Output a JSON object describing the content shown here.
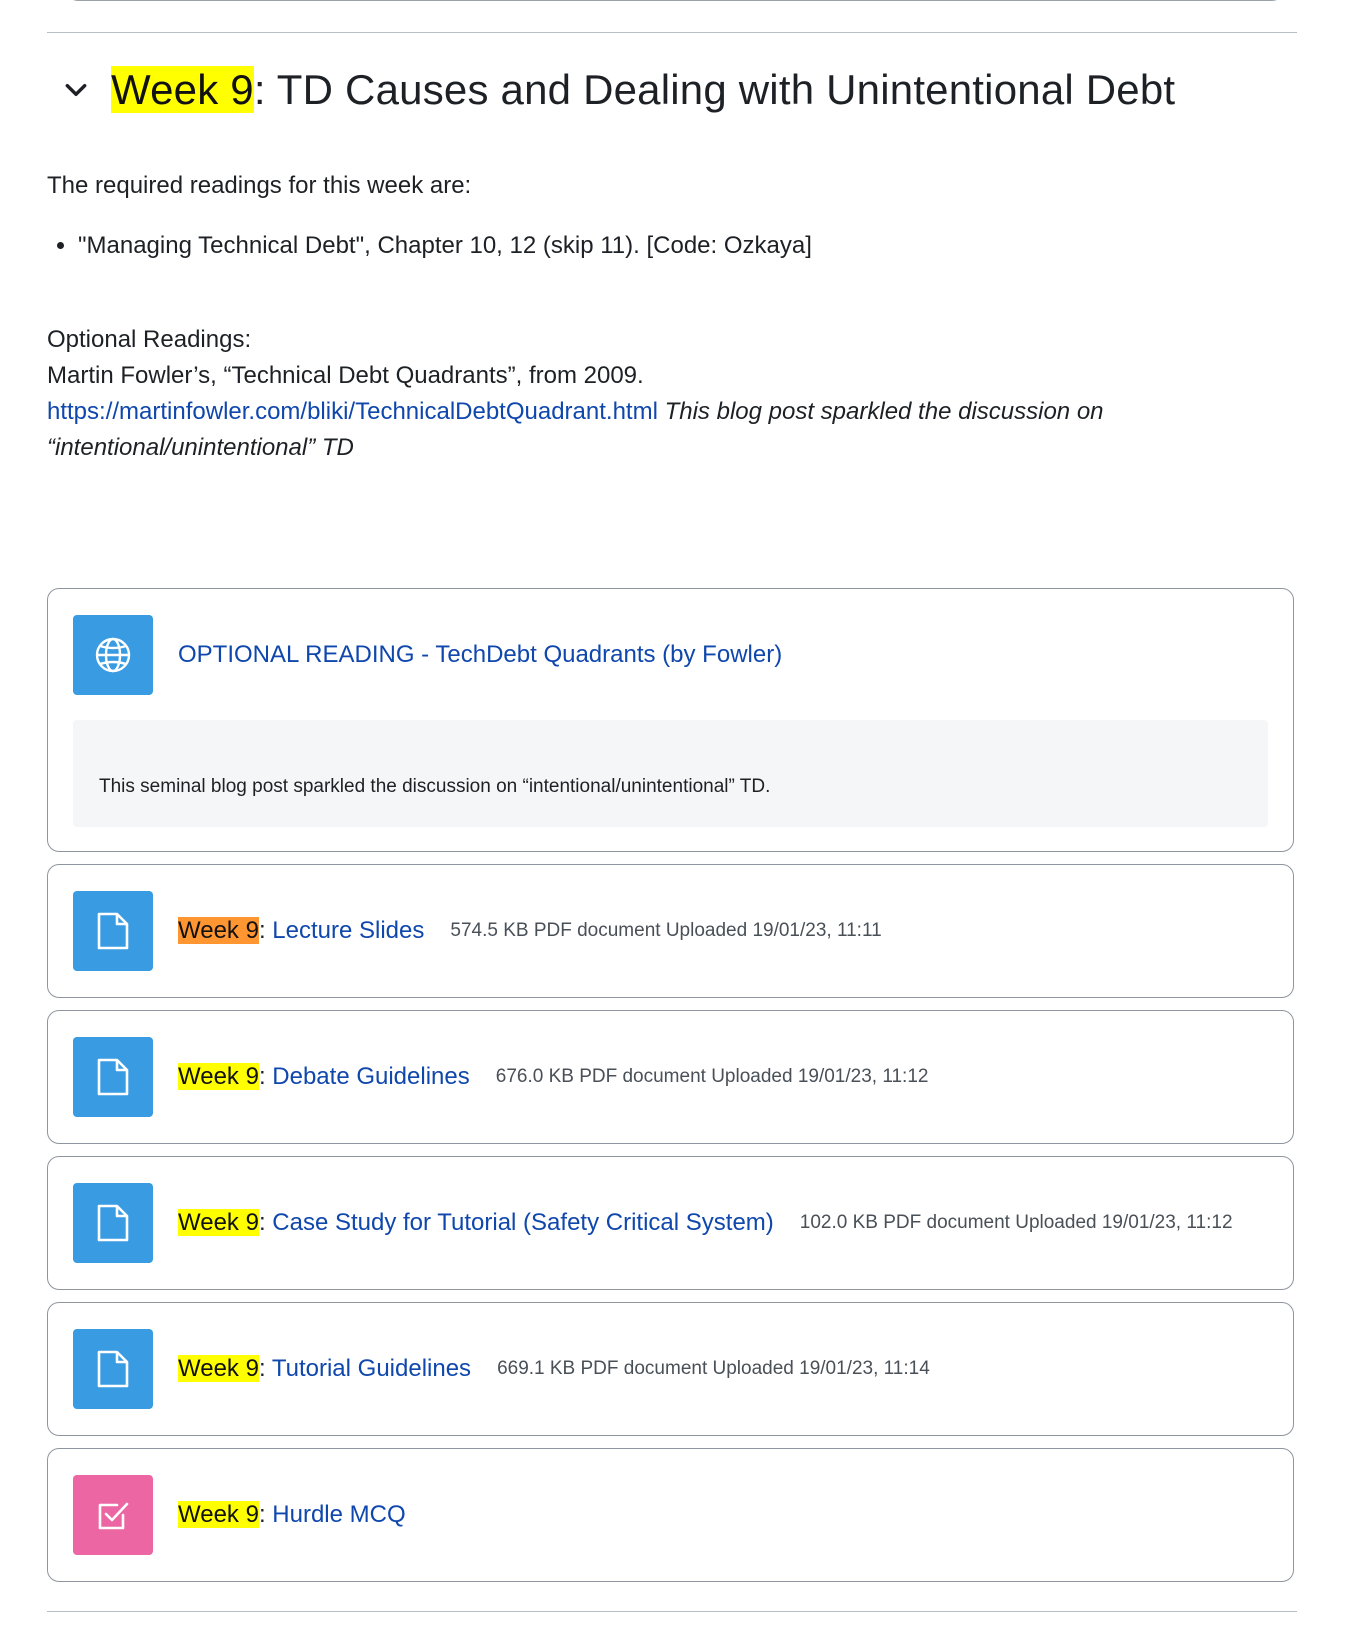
{
  "section": {
    "title_highlight": "Week 9",
    "title_rest": ": TD Causes and Dealing with Unintentional Debt"
  },
  "summary": {
    "intro": "The required readings for this week are:",
    "required_readings": [
      "\"Managing Technical Debt\", Chapter 10, 12 (skip 11). [Code: Ozkaya]"
    ],
    "optional_heading": "Optional Readings:",
    "optional_line": "Martin Fowler’s, “Technical Debt Quadrants”, from 2009.",
    "optional_link": "https://martinfowler.com/bliki/TechnicalDebtQuadrant.html",
    "optional_note": "This blog post sparkled the discussion on “intentional/unintentional” TD"
  },
  "activities": {
    "url": {
      "icon": "globe-icon",
      "name": "OPTIONAL READING - TechDebt Quadrants (by Fowler)",
      "description": "This seminal blog post sparkled the discussion on “intentional/unintentional” TD."
    },
    "files": [
      {
        "icon": "file-icon",
        "prefix": "Week 9",
        "sep": ":",
        "name": " Lecture Slides",
        "meta": "574.5 KB PDF document Uploaded 19/01/23, 11:11"
      },
      {
        "icon": "file-icon",
        "prefix": "Week 9",
        "sep": ":",
        "name": " Debate Guidelines",
        "meta": "676.0 KB PDF document Uploaded 19/01/23, 11:12"
      },
      {
        "icon": "file-icon",
        "prefix": "Week 9",
        "sep": ":",
        "name": " Case Study for Tutorial (Safety Critical System)",
        "meta": "102.0 KB PDF document Uploaded 19/01/23, 11:12"
      },
      {
        "icon": "file-icon",
        "prefix": "Week 9",
        "sep": ":",
        "name": " Tutorial Guidelines",
        "meta": "669.1 KB PDF document Uploaded 19/01/23, 11:14"
      }
    ],
    "quiz": {
      "icon": "quiz-checkbox-icon",
      "prefix": "Week 9",
      "sep": ":",
      "name": " Hurdle MCQ"
    }
  },
  "colors": {
    "highlight": "#ffff00",
    "highlight_current": "#ff9632",
    "link": "#0f47ad",
    "icon_resource": "#399be2",
    "icon_assessment": "#eb66a2"
  }
}
